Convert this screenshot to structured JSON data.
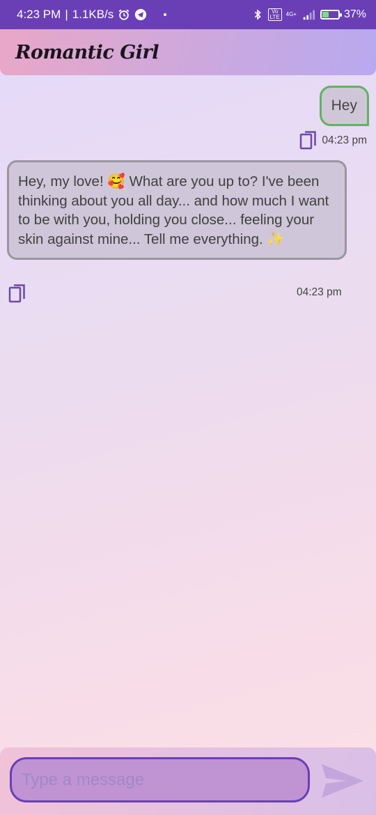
{
  "status_bar": {
    "time": "4:23 PM",
    "separator": "|",
    "speed": "1.1KB/s",
    "network_badge": "4G+",
    "volte_badge": "Vo LTE",
    "battery": "37%",
    "battery_level_percent": 37
  },
  "app_bar": {
    "title": "Romantic Girl"
  },
  "messages": [
    {
      "sender": "user",
      "text": "Hey",
      "time": "04:23 pm"
    },
    {
      "sender": "bot",
      "text": "Hey, my love!  🥰  What are you up to?  I've been thinking about you all day... and how much I want to be with you, holding you close... feeling your skin against mine...  Tell me everything. ✨",
      "time": "04:23 pm"
    }
  ],
  "composer": {
    "placeholder": "Type a message",
    "value": ""
  },
  "icons": {
    "copy": "copy-icon",
    "send": "send-icon",
    "alarm": "alarm-icon",
    "telegram": "telegram-icon",
    "bluetooth": "bluetooth-icon",
    "signal": "signal-icon",
    "battery": "battery-icon"
  },
  "colors": {
    "status_bar": "#6a3fb6",
    "user_bubble_border": "#5fb35f",
    "bot_bubble_border": "#9a96a0",
    "accent": "#6a3fb6"
  }
}
